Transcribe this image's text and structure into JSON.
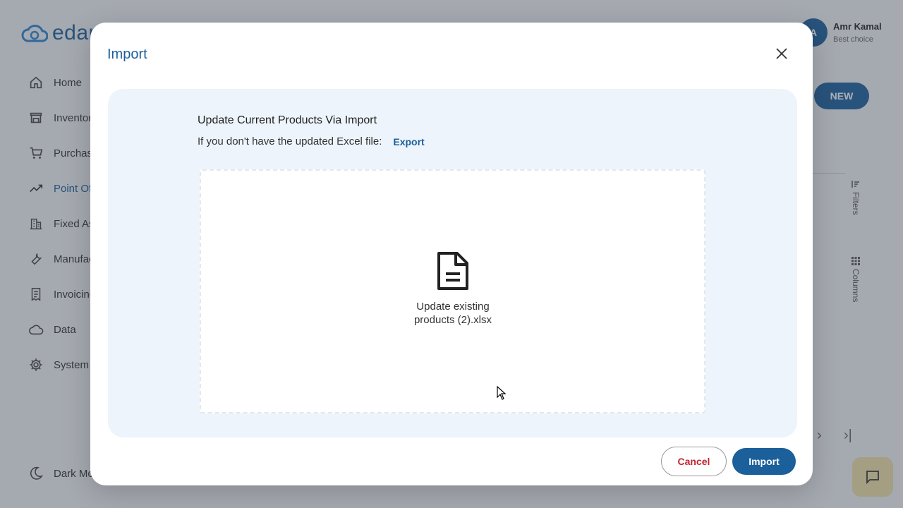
{
  "app": {
    "logo_text": "edar",
    "colors": {
      "brand": "#1b5f9b",
      "danger": "#c0262d",
      "panel_bg": "#edf4fb",
      "chat_bg": "#f0e0a8"
    },
    "sidebar": {
      "items": [
        {
          "label": "Home",
          "icon": "home-icon"
        },
        {
          "label": "Inventor",
          "icon": "store-icon"
        },
        {
          "label": "Purchas",
          "icon": "cart-icon"
        },
        {
          "label": "Point Of",
          "icon": "trend-icon"
        },
        {
          "label": "Fixed As",
          "icon": "building-icon"
        },
        {
          "label": "Manufac",
          "icon": "wrench-icon"
        },
        {
          "label": "Invoicing",
          "icon": "receipt-icon"
        },
        {
          "label": "Data",
          "icon": "cloud-icon"
        },
        {
          "label": "System",
          "icon": "gear-icon"
        }
      ],
      "active_index": 3,
      "dark_mode_label": "Dark Mo"
    },
    "user": {
      "initial": "A",
      "name": "Amr Kamal",
      "subtitle": "Best choice"
    },
    "new_button": "NEW",
    "filters_label": "Filters",
    "columns_label": "Columns"
  },
  "modal": {
    "title": "Import",
    "heading": "Update Current Products Via Import",
    "prompt_text": "If you don't have the updated Excel file:",
    "export_link": "Export",
    "file": {
      "name": "Update existing products (2).xlsx",
      "icon": "file-document-icon"
    },
    "cancel_label": "Cancel",
    "import_label": "Import"
  }
}
